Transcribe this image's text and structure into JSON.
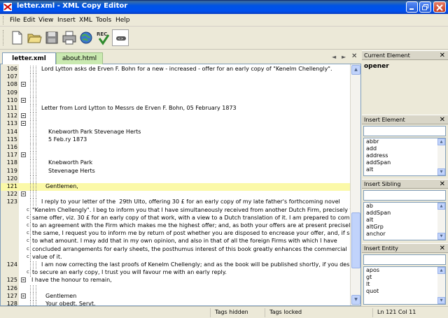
{
  "window": {
    "title": "letter.xml - XML Copy Editor"
  },
  "menu": {
    "items": [
      "File",
      "Edit",
      "View",
      "Insert",
      "XML",
      "Tools",
      "Help"
    ]
  },
  "toolbar": {
    "buttons": [
      "new-icon",
      "open-icon",
      "save-icon",
      "print-icon",
      "browser-icon",
      "validate-icon",
      "hide-tags-icon"
    ]
  },
  "tabs": {
    "active": "letter.xml",
    "inactive": "about.html"
  },
  "editor": {
    "lines": [
      {
        "n": "106",
        "fold": false,
        "text": "Lord Lytton asks de Erven F. Bohn for a new - increased - offer for an early copy of \"Kenelm Chellengly\"."
      },
      {
        "n": "107",
        "fold": false,
        "text": ""
      },
      {
        "n": "108",
        "fold": true,
        "text": ""
      },
      {
        "n": "109",
        "fold": false,
        "text": ""
      },
      {
        "n": "110",
        "fold": true,
        "text": ""
      },
      {
        "n": "111",
        "fold": false,
        "text": "Letter from Lord Lytton to Messrs de Erven F. Bohn, 05 February 1873"
      },
      {
        "n": "112",
        "fold": true,
        "text": ""
      },
      {
        "n": "113",
        "fold": true,
        "text": ""
      },
      {
        "n": "114",
        "fold": false,
        "text": "Knebworth Park Stevenage Herts"
      },
      {
        "n": "115",
        "fold": false,
        "text": "5 Feb.ry 1873"
      },
      {
        "n": "116",
        "fold": false,
        "text": ""
      },
      {
        "n": "117",
        "fold": true,
        "text": ""
      },
      {
        "n": "118",
        "fold": false,
        "text": "Knebworth Park"
      },
      {
        "n": "119",
        "fold": false,
        "text": "Stevenage Herts"
      },
      {
        "n": "120",
        "fold": false,
        "text": ""
      },
      {
        "n": "121",
        "fold": false,
        "text": "Gentlemen,"
      },
      {
        "n": "122",
        "fold": true,
        "text": ""
      },
      {
        "n": "123",
        "fold": false,
        "text": "I reply to your letter of the  29th Ulto, offering 30 £ for an early copy of my late father's forthcoming novel"
      },
      {
        "n": "",
        "fold": false,
        "text": "\"Kenelm Chellengly\". I beg to inform you that I have simultaneously received from another Dutch Firm, precisely the"
      },
      {
        "n": "",
        "fold": false,
        "text": "same offer, viz. 30 £ for an early copy of that work, with a view to a Dutch translation of it. I am prepared to come"
      },
      {
        "n": "",
        "fold": false,
        "text": "to an agreement with the Firm which makes me the highest offer; and, as both your offers are at present precisely"
      },
      {
        "n": "",
        "fold": false,
        "text": "the same, I request you to inform me by return of post whether you are disposed to encrease your offer, and, if so,"
      },
      {
        "n": "",
        "fold": false,
        "text": "to what amount. I may add that in my own opinion, and also in that of all the foreign Firms with which I have"
      },
      {
        "n": "",
        "fold": false,
        "text": "concluded arrangements for early sheets, the posthumus interest of this book greatly enhances the commercial"
      },
      {
        "n": "",
        "fold": false,
        "text": "value of it."
      },
      {
        "n": "124",
        "fold": false,
        "text": "I am now correcting the last proofs of Kenelm Chellengly; and as the book will be published shortly, if you desire"
      },
      {
        "n": "",
        "fold": false,
        "text": "to secure an early copy, I trust you will favour me with an early reply."
      },
      {
        "n": "125",
        "fold": true,
        "text": "I have the honour to remain,"
      },
      {
        "n": "126",
        "fold": false,
        "text": ""
      },
      {
        "n": "127",
        "fold": true,
        "text": "Gentlemen"
      },
      {
        "n": "128",
        "fold": false,
        "text": "Your obedt. Servt."
      }
    ]
  },
  "panels": {
    "current_element": {
      "title": "Current Element",
      "value": "opener"
    },
    "insert_element": {
      "title": "Insert Element",
      "items": [
        "abbr",
        "add",
        "address",
        "addSpan",
        "alt"
      ]
    },
    "insert_sibling": {
      "title": "Insert Sibling",
      "items": [
        "ab",
        "addSpan",
        "alt",
        "altGrp",
        "anchor"
      ]
    },
    "insert_entity": {
      "title": "Insert Entity",
      "items": [
        "apos",
        "gt",
        "lt",
        "quot"
      ]
    }
  },
  "status": {
    "tags_hidden": "Tags hidden",
    "tags_locked": "Tags locked",
    "position": "Ln 121 Col 11"
  },
  "colors": {
    "highlight": "#fbf9a8",
    "titlebar": "#0054e3",
    "inactive_tab": "#c9e9b0"
  }
}
